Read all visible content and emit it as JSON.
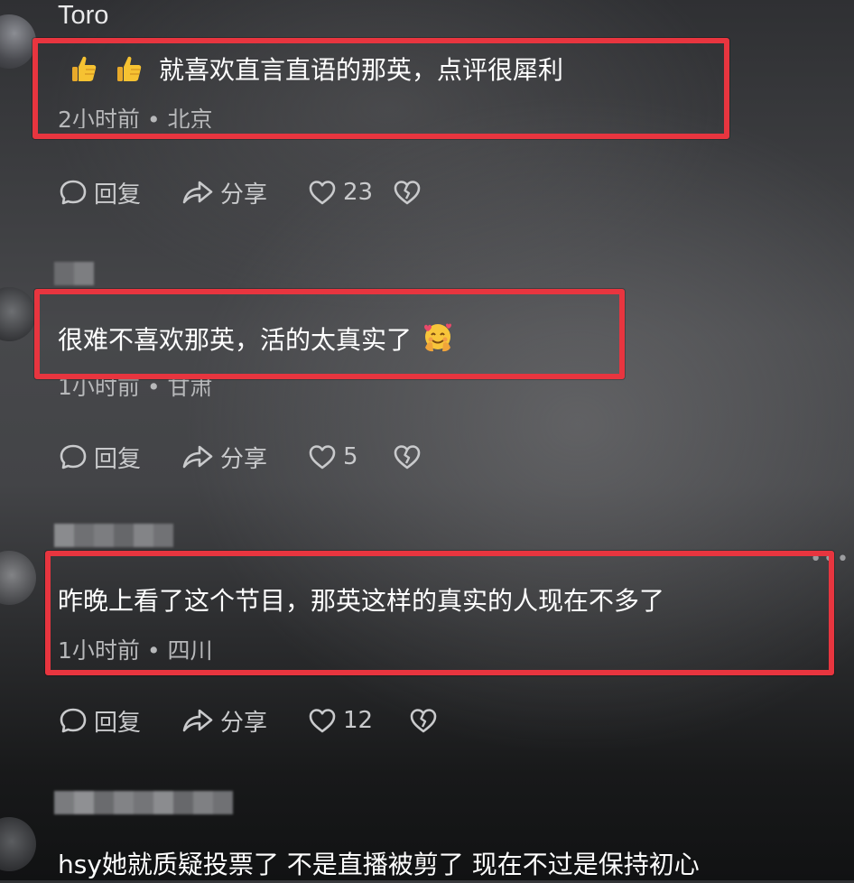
{
  "comments": [
    {
      "username": "Toro",
      "text": "就喜欢直言直语的那英，点评很犀利",
      "leading_emoji": [
        "thumbs-up-icon",
        "thumbs-up-icon"
      ],
      "meta": "2小时前 • 北京",
      "reply_label": "回复",
      "share_label": "分享",
      "likes": "23"
    },
    {
      "username": "",
      "text": "很难不喜欢那英，活的太真实了",
      "trailing_emoji": "smiling-face-with-hearts-hug-icon",
      "meta": "1小时前 • 甘肃",
      "reply_label": "回复",
      "share_label": "分享",
      "likes": "5"
    },
    {
      "username": "",
      "text": "昨晚上看了这个节目，那英这样的真实的人现在不多了",
      "meta": "1小时前 • 四川",
      "reply_label": "回复",
      "share_label": "分享",
      "likes": "12"
    },
    {
      "username": "",
      "text": "hsy她就质疑投票了 不是直播被剪了 现在不过是保持初心"
    }
  ],
  "colors": {
    "highlight": "#e8353f",
    "text": "#ffffff",
    "meta": "#b7b8ba",
    "action": "#c9cacc"
  }
}
